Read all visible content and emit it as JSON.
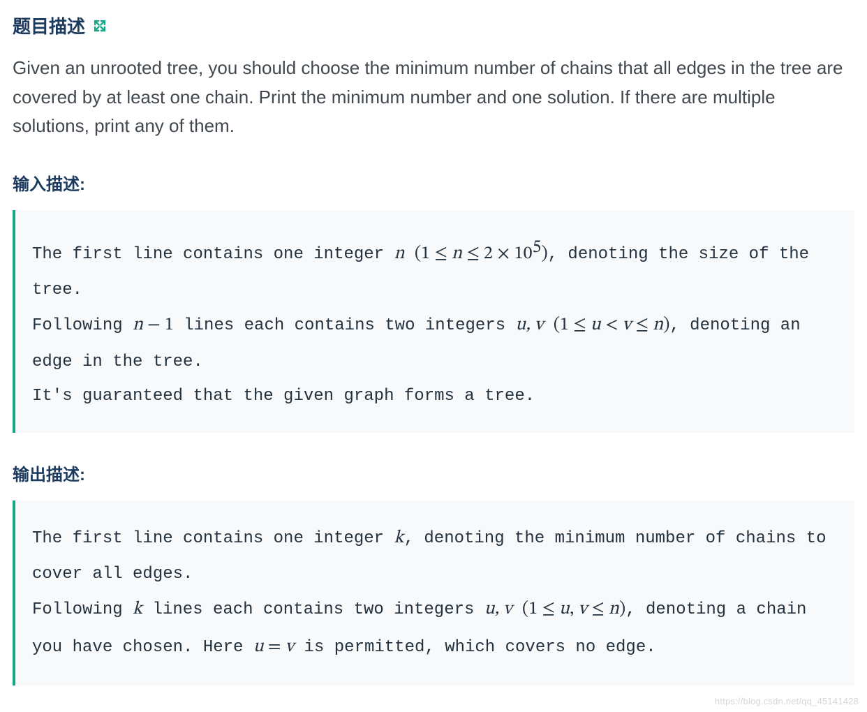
{
  "headings": {
    "problem": "题目描述",
    "input": "输入描述:",
    "output": "输出描述:"
  },
  "problem_text": "Given an unrooted tree, you should choose the minimum number of chains that all edges in the tree are covered by at least one chain. Print the minimum number and one solution. If there are multiple solutions, print any of them.",
  "input_desc": {
    "l1a": "The first line contains one integer ",
    "l1b": ", denoting the size of the tree.",
    "l2a": "Following ",
    "l2b": " lines each contains two integers ",
    "l2c": ", denoting an edge in the tree.",
    "l3": "It's guaranteed that the given graph forms a tree."
  },
  "output_desc": {
    "l1a": "The first line contains one integer ",
    "l1b": ", denoting the minimum number of chains to cover all edges.",
    "l2a": "Following ",
    "l2b": " lines each contains two integers ",
    "l2c": ", denoting a chain you have chosen. Here ",
    "l2d": " is permitted, which covers no edge."
  },
  "math": {
    "n": "n",
    "n_range_open": "(1 ≤ ",
    "n_range_mid": " ≤ 2 × 10",
    "exp5": "5",
    "n_range_close": ")",
    "n_minus_1_a": "n",
    "n_minus_1_b": " − 1",
    "uv": "u, v",
    "uv_range1": "(1 ≤ ",
    "uv_range1b": " < ",
    "uv_range1c": " ≤ ",
    "uv_range1d": ")",
    "k": "k",
    "uv_range2": "(1 ≤ ",
    "uv_range2b": ", ",
    "uv_range2c": " ≤ ",
    "uv_range2d": ")",
    "u_eq_v_a": "u",
    "u_eq_v_b": " = ",
    "u_eq_v_c": "v",
    "u": "u",
    "v": "v"
  },
  "watermark": "https://blog.csdn.net/qq_45141428"
}
